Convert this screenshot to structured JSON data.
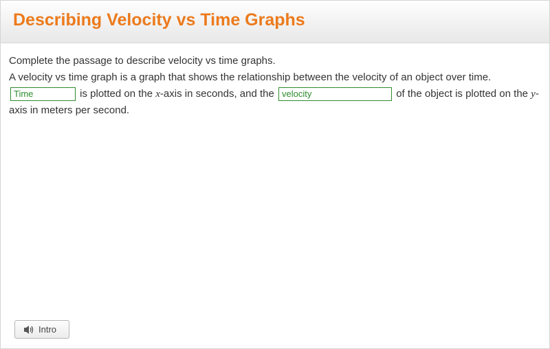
{
  "header": {
    "title": "Describing Velocity vs Time Graphs"
  },
  "content": {
    "intro_sentence": "Complete the passage to describe velocity vs time graphs.",
    "line2": "A velocity vs time graph is a graph that shows the relationship between the velocity of an object over time.",
    "blank1_value": "Time",
    "seg1": " is plotted on the ",
    "x_letter": "x",
    "seg2": "-axis in seconds, and the ",
    "blank2_value": "velocity",
    "seg3": " of the object is plotted on the ",
    "y_letter": "y",
    "seg4": "-axis in meters per second."
  },
  "footer": {
    "intro_label": "Intro"
  }
}
